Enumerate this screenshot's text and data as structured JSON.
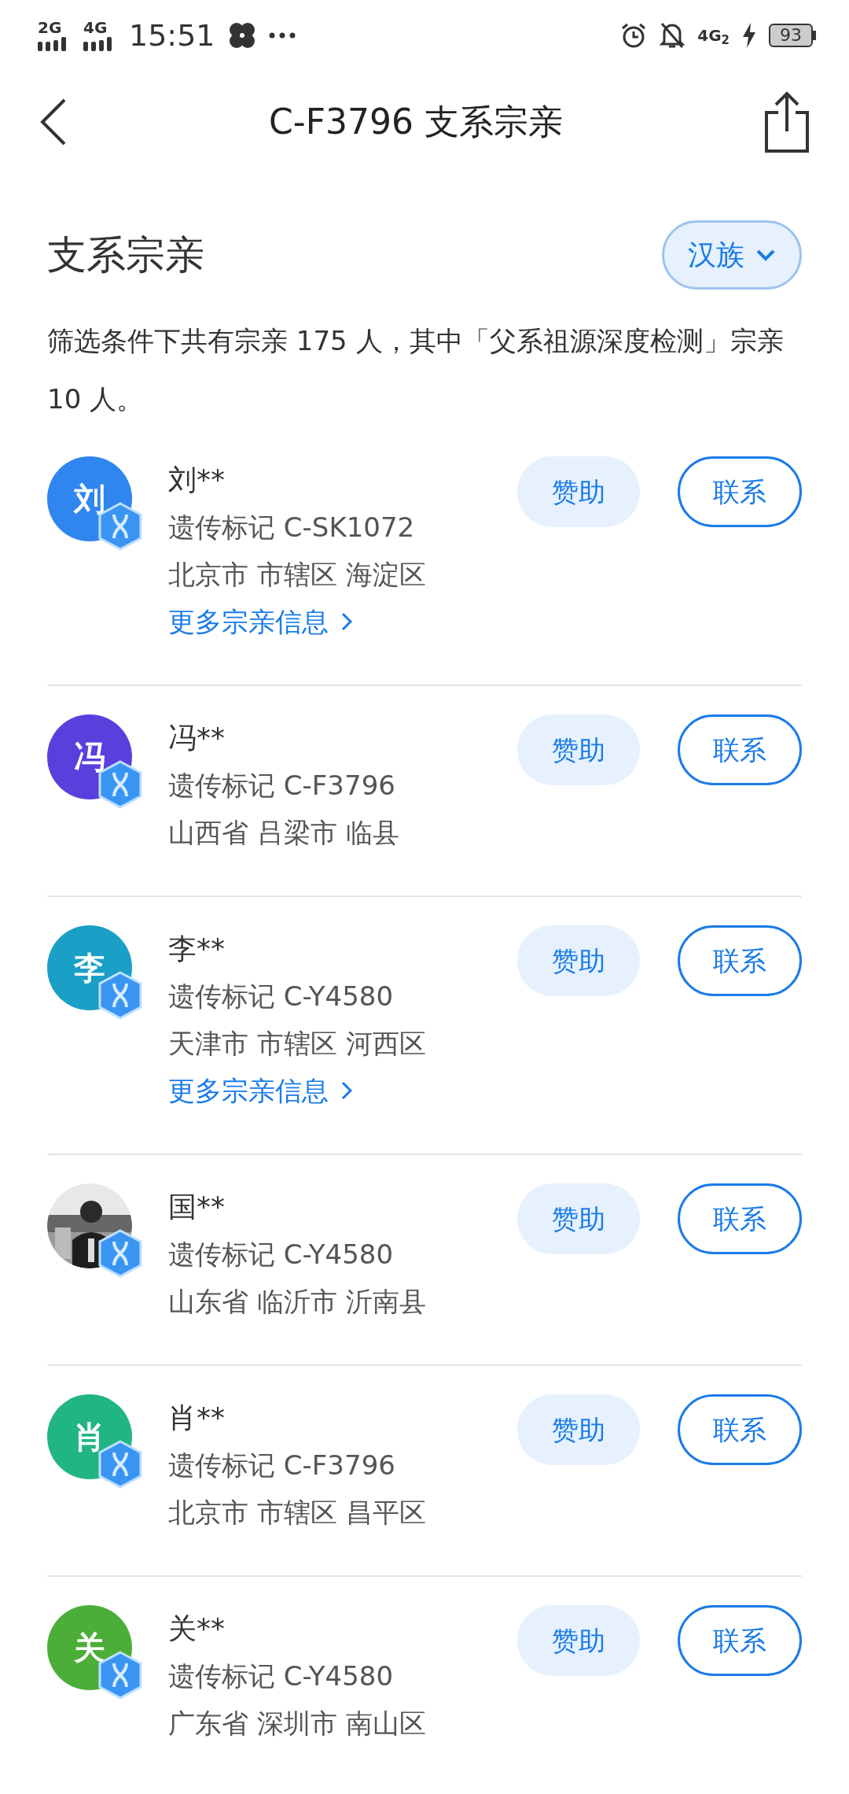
{
  "status_bar": {
    "network_1": "2G",
    "network_2": "4G",
    "time": "15:51",
    "network_3": "4G$_{2}$",
    "battery": "93"
  },
  "header": {
    "title": "C-F3796 支系宗亲"
  },
  "section": {
    "title": "支系宗亲",
    "filter": {
      "label": "汉族"
    },
    "summary": "筛选条件下共有宗亲 175 人，其中「父系祖源深度检测」宗亲 10 人。"
  },
  "relatives": [
    {
      "kind": "letter",
      "initial": "刘",
      "color": "#2f86ee",
      "name": "刘**",
      "marker": "遗传标记 C-SK1072",
      "location": "北京市 市辖区 海淀区",
      "more_link": "更多宗亲信息",
      "sponsor": "赞助",
      "contact": "联系"
    },
    {
      "kind": "letter",
      "initial": "冯",
      "color": "#5b3fdc",
      "name": "冯**",
      "marker": "遗传标记 C-F3796",
      "location": "山西省 吕梁市 临县",
      "sponsor": "赞助",
      "contact": "联系"
    },
    {
      "kind": "letter",
      "initial": "李",
      "color": "#1a9fc6",
      "name": "李**",
      "marker": "遗传标记 C-Y4580",
      "location": "天津市 市辖区 河西区",
      "more_link": "更多宗亲信息",
      "sponsor": "赞助",
      "contact": "联系"
    },
    {
      "kind": "picture",
      "name": "国**",
      "marker": "遗传标记 C-Y4580",
      "location": "山东省 临沂市 沂南县",
      "sponsor": "赞助",
      "contact": "联系"
    },
    {
      "kind": "letter",
      "initial": "肖",
      "color": "#22b584",
      "name": "肖**",
      "marker": "遗传标记 C-F3796",
      "location": "北京市 市辖区 昌平区",
      "sponsor": "赞助",
      "contact": "联系"
    },
    {
      "kind": "letter",
      "initial": "关",
      "color": "#4cae38",
      "name": "关**",
      "marker": "遗传标记 C-Y4580",
      "location": "广东省 深圳市 南山区",
      "sponsor": "赞助",
      "contact": "联系"
    }
  ]
}
